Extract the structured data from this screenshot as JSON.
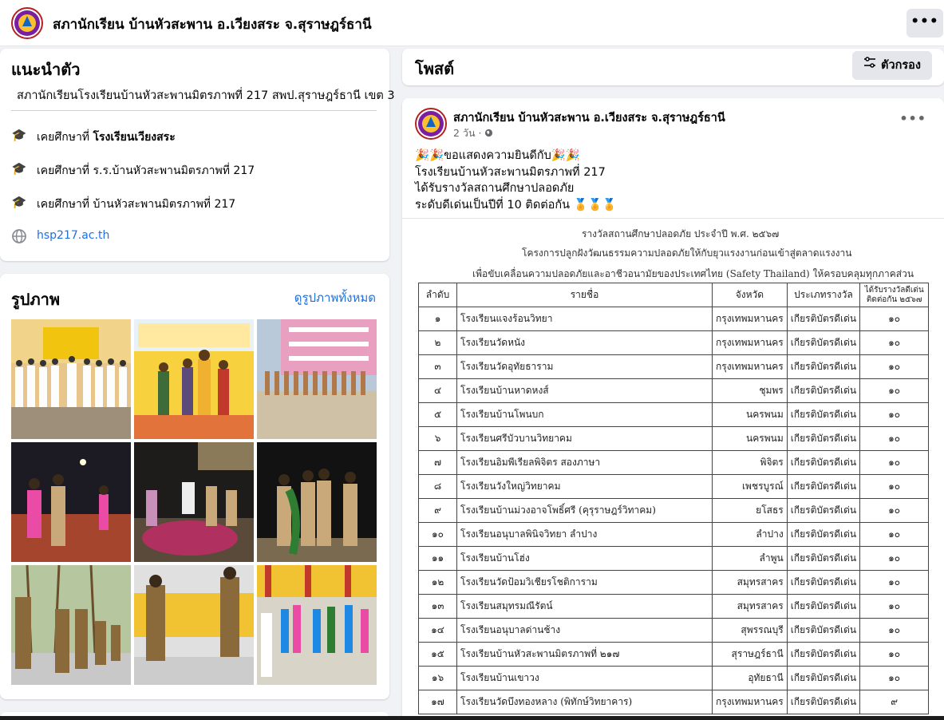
{
  "header": {
    "page_name": "สภานักเรียน บ้านหัวสะพาน อ.เวียงสระ จ.สุราษฎร์ธานี",
    "more_label": "•••"
  },
  "intro": {
    "title": "แนะนำตัว",
    "bio": "สภานักเรียนโรงเรียนบ้านหัวสะพานมิตรภาพที่ 217 สพป.สุราษฎร์ธานี เขต 3",
    "items": [
      {
        "prefix": "เคยศึกษาที่ ",
        "value": "โรงเรียนเวียงสระ",
        "icon": "graduation-cap-icon"
      },
      {
        "prefix": "เคยศึกษาที่ ",
        "value": "ร.ร.บ้านหัวสะพานมิตรภาพที่ 217",
        "icon": "graduation-cap-icon"
      },
      {
        "prefix": "เคยศึกษาที่ ",
        "value": "บ้านหัวสะพานมิตรภาพที่ 217",
        "icon": "graduation-cap-icon"
      }
    ],
    "website": "hsp217.ac.th"
  },
  "photos": {
    "title": "รูปภาพ",
    "see_all": "ดูรูปภาพทั้งหมด"
  },
  "posts": {
    "title": "โพสต์",
    "filter_label": "ตัวกรอง"
  },
  "post": {
    "author": "สภานักเรียน บ้านหัวสะพาน อ.เวียงสระ จ.สุราษฎร์ธานี",
    "time": "2 วัน",
    "line1": "🎉🎉ขอแสดงความยินดีกับ🎉🎉",
    "line2": "โรงเรียนบ้านหัวสะพานมิตรภาพที่ 217",
    "line3": "ได้รับรางวัลสถานศึกษาปลอดภัย",
    "line4": "ระดับดีเด่นเป็นปีที่ 10 ติดต่อกัน 🏅🏅🏅",
    "doc": {
      "title": "รางวัลสถานศึกษาปลอดภัย ประจำปี พ.ศ. ๒๕๖๗",
      "subtitle1": "โครงการปลูกฝังวัฒนธรรมความปลอดภัยให้กับยุวแรงงานก่อนเข้าสู่ตลาดแรงงาน",
      "subtitle2": "เพื่อขับเคลื่อนความปลอดภัยและอาชีวอนามัยของประเทศไทย (Safety Thailand) ให้ครอบคลุมทุกภาคส่วน",
      "headers": {
        "no": "ลำดับ",
        "name": "รายชื่อ",
        "province": "จังหวัด",
        "type": "ประเภทรางวัล",
        "years": "ได้รับรางวัลดีเด่น ติดต่อกัน ๒๕๖๗"
      },
      "rows": [
        {
          "no": "๑",
          "name": "โรงเรียนแจงร้อนวิทยา",
          "province": "กรุงเทพมหานคร",
          "type": "เกียรติบัตรดีเด่น",
          "years": "๑๐"
        },
        {
          "no": "๒",
          "name": "โรงเรียนวัดหนัง",
          "province": "กรุงเทพมหานคร",
          "type": "เกียรติบัตรดีเด่น",
          "years": "๑๐"
        },
        {
          "no": "๓",
          "name": "โรงเรียนวัดอุทัยธาราม",
          "province": "กรุงเทพมหานคร",
          "type": "เกียรติบัตรดีเด่น",
          "years": "๑๐"
        },
        {
          "no": "๔",
          "name": "โรงเรียนบ้านหาดหงส์",
          "province": "ชุมพร",
          "type": "เกียรติบัตรดีเด่น",
          "years": "๑๐"
        },
        {
          "no": "๕",
          "name": "โรงเรียนบ้านโพนบก",
          "province": "นครพนม",
          "type": "เกียรติบัตรดีเด่น",
          "years": "๑๐"
        },
        {
          "no": "๖",
          "name": "โรงเรียนศรีบัวบานวิทยาคม",
          "province": "นครพนม",
          "type": "เกียรติบัตรดีเด่น",
          "years": "๑๐"
        },
        {
          "no": "๗",
          "name": "โรงเรียนอิมพีเรียลพิจิตร สองภาษา",
          "province": "พิจิตร",
          "type": "เกียรติบัตรดีเด่น",
          "years": "๑๐"
        },
        {
          "no": "๘",
          "name": "โรงเรียนวังใหญ่วิทยาคม",
          "province": "เพชรบูรณ์",
          "type": "เกียรติบัตรดีเด่น",
          "years": "๑๐"
        },
        {
          "no": "๙",
          "name": "โรงเรียนบ้านม่วงอาจโพธิ์ศรี (คุรุราษฎร์วิทาคม)",
          "province": "ยโสธร",
          "type": "เกียรติบัตรดีเด่น",
          "years": "๑๐"
        },
        {
          "no": "๑๐",
          "name": "โรงเรียนอนุบาลพินิจวิทยา ลำปาง",
          "province": "ลำปาง",
          "type": "เกียรติบัตรดีเด่น",
          "years": "๑๐"
        },
        {
          "no": "๑๑",
          "name": "โรงเรียนบ้านโฮ่ง",
          "province": "ลำพูน",
          "type": "เกียรติบัตรดีเด่น",
          "years": "๑๐"
        },
        {
          "no": "๑๒",
          "name": "โรงเรียนวัดป้อมวิเชียรโชติการาม",
          "province": "สมุทรสาคร",
          "type": "เกียรติบัตรดีเด่น",
          "years": "๑๐"
        },
        {
          "no": "๑๓",
          "name": "โรงเรียนสมุทรมณีรัตน์",
          "province": "สมุทรสาคร",
          "type": "เกียรติบัตรดีเด่น",
          "years": "๑๐"
        },
        {
          "no": "๑๔",
          "name": "โรงเรียนอนุบาลด่านช้าง",
          "province": "สุพรรณบุรี",
          "type": "เกียรติบัตรดีเด่น",
          "years": "๑๐"
        },
        {
          "no": "๑๕",
          "name": "โรงเรียนบ้านหัวสะพานมิตรภาพที่ ๒๑๗",
          "province": "สุราษฎร์ธานี",
          "type": "เกียรติบัตรดีเด่น",
          "years": "๑๐"
        },
        {
          "no": "๑๖",
          "name": "โรงเรียนบ้านเขาวง",
          "province": "อุทัยธานี",
          "type": "เกียรติบัตรดีเด่น",
          "years": "๑๐"
        },
        {
          "no": "๑๗",
          "name": "โรงเรียนวัดบึงทองหลาง (พิทักษ์วิทยาคาร)",
          "province": "กรุงเทพมหานคร",
          "type": "เกียรติบัตรดีเด่น",
          "years": "๙"
        }
      ]
    }
  }
}
